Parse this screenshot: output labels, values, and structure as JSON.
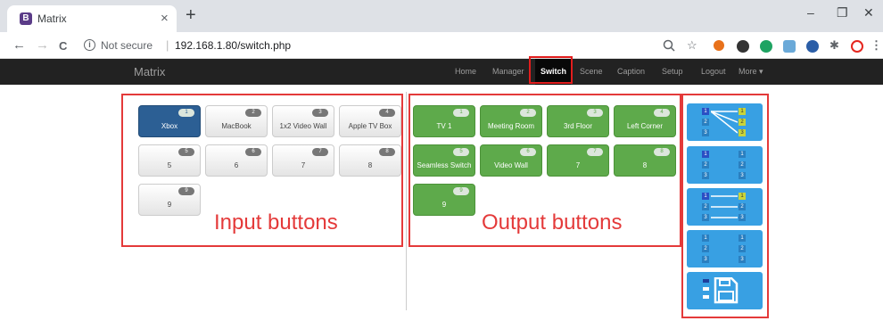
{
  "browser": {
    "tab_title": "Matrix",
    "tab_icon_letter": "B",
    "tab_close": "×",
    "new_tab": "+",
    "window_buttons": {
      "minimize": "–",
      "restore": "❐",
      "close": "✕"
    },
    "nav": {
      "back": "←",
      "forward": "→",
      "reload": "C"
    },
    "security_label": "Not secure",
    "url": "192.168.1.80/switch.php"
  },
  "app": {
    "brand": "Matrix",
    "nav": {
      "home": "Home",
      "manager": "Manager",
      "switch": "Switch",
      "scene": "Scene",
      "caption": "Caption",
      "setup": "Setup",
      "logout": "Logout",
      "more": "More ▾"
    },
    "active_nav": "switch"
  },
  "inputs": [
    {
      "number": "1",
      "label": "Xbox",
      "selected": true
    },
    {
      "number": "2",
      "label": "MacBook",
      "selected": false
    },
    {
      "number": "3",
      "label": "1x2 Video Wall",
      "selected": false
    },
    {
      "number": "4",
      "label": "Apple TV Box",
      "selected": false
    },
    {
      "number": "5",
      "label": "5",
      "selected": false
    },
    {
      "number": "6",
      "label": "6",
      "selected": false
    },
    {
      "number": "7",
      "label": "7",
      "selected": false
    },
    {
      "number": "8",
      "label": "8",
      "selected": false
    },
    {
      "number": "9",
      "label": "9",
      "selected": false
    }
  ],
  "outputs": [
    {
      "number": "1",
      "label": "TV 1"
    },
    {
      "number": "2",
      "label": "Meeting Room"
    },
    {
      "number": "3",
      "label": "3rd Floor"
    },
    {
      "number": "4",
      "label": "Left Corner"
    },
    {
      "number": "5",
      "label": "Seamless Switch"
    },
    {
      "number": "6",
      "label": "Video Wall"
    },
    {
      "number": "7",
      "label": "7"
    },
    {
      "number": "8",
      "label": "8"
    },
    {
      "number": "9",
      "label": "9"
    }
  ],
  "captions": {
    "inputs": "Input buttons",
    "outputs": "Output buttons"
  },
  "presets": {
    "one_to_all": {
      "left": [
        "1",
        "2",
        "3"
      ],
      "right": [
        "1",
        "2",
        "3"
      ]
    },
    "clear": {
      "left": [
        "1",
        "2",
        "3"
      ],
      "right": [
        "1",
        "2",
        "3"
      ]
    },
    "one_to_one": {
      "left": [
        "1",
        "2",
        "3"
      ],
      "right": [
        "1",
        "2",
        "3"
      ]
    },
    "none": {
      "left": [
        "1",
        "2",
        "3"
      ],
      "right": [
        "1",
        "2",
        "3"
      ]
    }
  },
  "colors": {
    "selected_input": "#2c5f94",
    "output_green": "#5eaa4b",
    "preset_blue": "#38a0e3",
    "annotation_red": "#e43a3a"
  }
}
